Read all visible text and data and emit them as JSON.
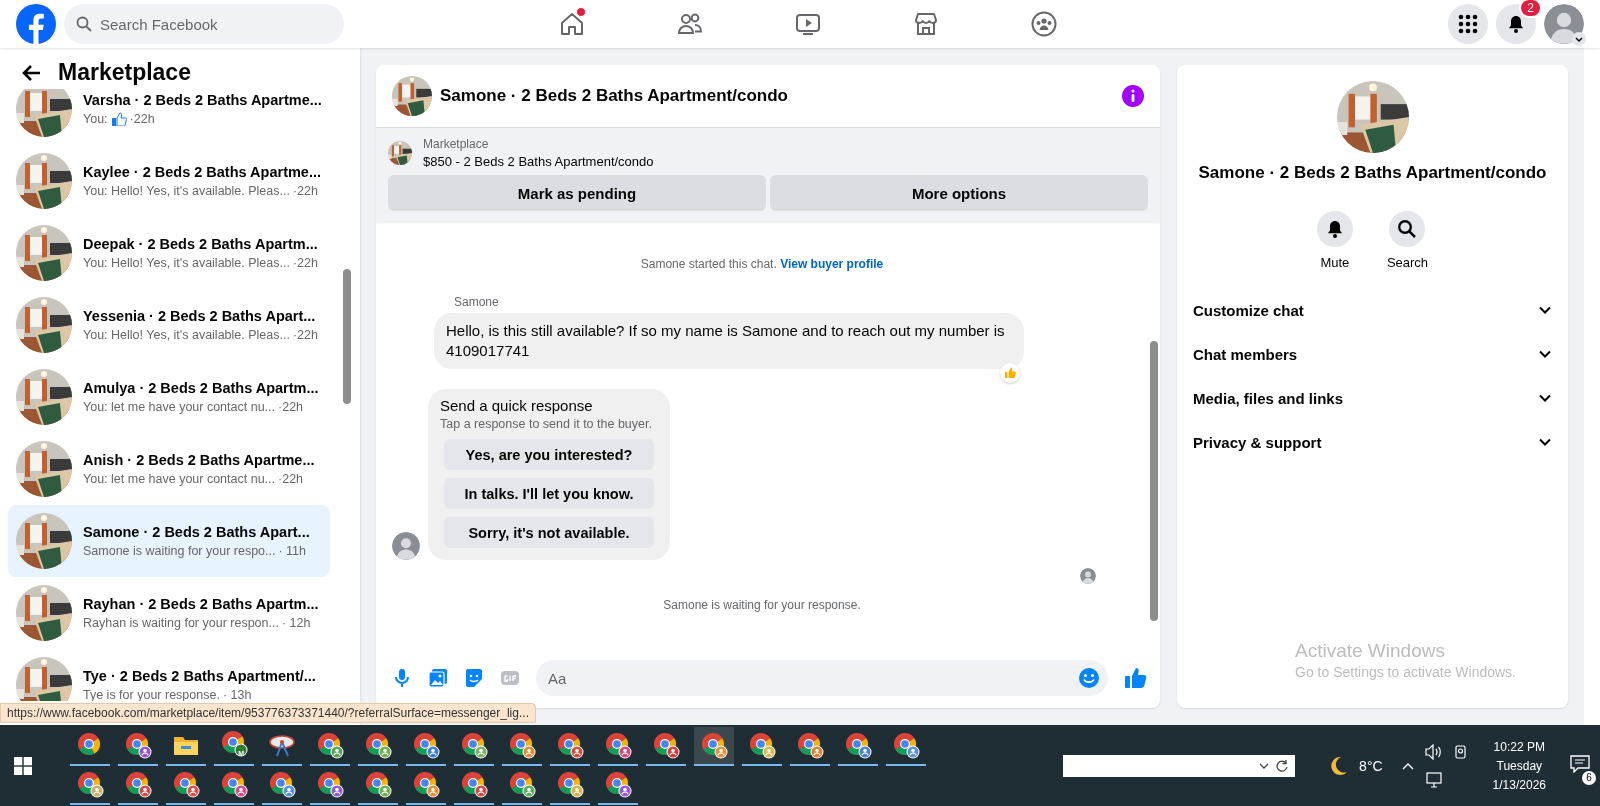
{
  "topbar": {
    "search": {
      "placeholder": "Search Facebook"
    },
    "nav": [
      {
        "kind": "home",
        "alert": true
      },
      {
        "kind": "friends",
        "alert": false
      },
      {
        "kind": "video",
        "alert": false
      },
      {
        "kind": "marketplace",
        "alert": false
      },
      {
        "kind": "groups",
        "alert": false
      }
    ],
    "notifications_badge": "2"
  },
  "sidebar": {
    "title": "Marketplace",
    "conversations": [
      {
        "name": "Varsha · 2 Beds 2 Baths Apartme...",
        "preview": "You:",
        "like_icon": true,
        "time": "·22h",
        "selected": false
      },
      {
        "name": "Kaylee · 2 Beds 2 Baths Apartme...",
        "preview": "You: Hello! Yes, it's available. Pleas...",
        "like_icon": false,
        "time": "·22h",
        "selected": false
      },
      {
        "name": "Deepak · 2 Beds 2 Baths Apartm...",
        "preview": "You: Hello! Yes, it's available. Pleas...",
        "like_icon": false,
        "time": "·22h",
        "selected": false
      },
      {
        "name": "Yessenia · 2 Beds 2 Baths Apart...",
        "preview": "You: Hello! Yes, it's available. Pleas...",
        "like_icon": false,
        "time": "·22h",
        "selected": false
      },
      {
        "name": "Amulya · 2 Beds 2 Baths Apartm...",
        "preview": "You: let me have your contact nu...",
        "like_icon": false,
        "time": "·22h",
        "selected": false
      },
      {
        "name": "Anish · 2 Beds 2 Baths Apartme...",
        "preview": "You: let me have your contact nu...",
        "like_icon": false,
        "time": "·22h",
        "selected": false
      },
      {
        "name": "Samone · 2 Beds 2 Baths Apart...",
        "preview": "Samone is waiting for your respo...",
        "like_icon": false,
        "time": "· 11h",
        "selected": true
      },
      {
        "name": "Rayhan · 2 Beds 2 Baths Apartm...",
        "preview": "Rayhan is waiting for your respon...",
        "like_icon": false,
        "time": "· 12h",
        "selected": false
      },
      {
        "name": "Tye · 2 Beds 2 Baths Apartment/...",
        "preview": "Tye is for your response.",
        "like_icon": false,
        "time": "· 13h",
        "selected": false
      }
    ]
  },
  "chat": {
    "title": "Samone · 2 Beds 2 Baths Apartment/condo",
    "listing": {
      "label": "Marketplace",
      "title": "$850 - 2 Beds 2 Baths Apartment/condo"
    },
    "actions": [
      "Mark as pending",
      "More options"
    ],
    "started": {
      "text": "Samone started this chat.",
      "link": "View buyer profile"
    },
    "messages": [
      {
        "sender": "Samone",
        "text": "Hello, is this still available? If so my name is Samone and to reach out my number is 4109017741",
        "reaction": true
      }
    ],
    "quick_response": {
      "title": "Send a quick response",
      "subtitle": "Tap a response to send it to the buyer.",
      "options": [
        "Yes, are you interested?",
        "In talks. I'll let you know.",
        "Sorry, it's not available."
      ]
    },
    "waiting": "Samone is waiting for your response.",
    "composer": {
      "placeholder": "Aa"
    }
  },
  "details": {
    "title": "Samone · 2 Beds 2 Baths Apartment/condo",
    "actions": [
      {
        "kind": "mute",
        "label": "Mute"
      },
      {
        "kind": "search",
        "label": "Search"
      }
    ],
    "sections": [
      {
        "label": "Customize chat",
        "expanded": false
      },
      {
        "label": "Chat members",
        "expanded": false
      },
      {
        "label": "Media, files and links",
        "expanded": false
      },
      {
        "label": "Privacy & support",
        "expanded": false
      }
    ],
    "watermark": {
      "title": "Activate Windows",
      "subtitle": "Go to Settings to activate Windows."
    }
  },
  "status_url": "https://www.facebook.com/marketplace/item/953776373371440/?referralSurface=messenger_lig...",
  "taskbar": {
    "apps": [
      {
        "kind": "chrome",
        "selected": false
      },
      {
        "kind": "chrome-profile",
        "color": "#9c4fd6",
        "selected": false
      },
      {
        "kind": "folder",
        "selected": false
      },
      {
        "kind": "chrome-letter",
        "letter": "M",
        "color": "#2e7d32",
        "selected": false
      },
      {
        "kind": "dish",
        "selected": false
      },
      {
        "kind": "chrome-profile",
        "color": "#5aa35a",
        "selected": false
      },
      {
        "kind": "chrome-profile",
        "color": "#6fae4f",
        "selected": false
      },
      {
        "kind": "chrome-profile",
        "color": "#3b7dd8",
        "selected": false
      },
      {
        "kind": "chrome-profile",
        "color": "#7fb069",
        "selected": false
      },
      {
        "kind": "chrome-profile",
        "color": "#e08a2c",
        "selected": false
      },
      {
        "kind": "chrome-profile",
        "color": "#e0483e",
        "selected": false
      },
      {
        "kind": "chrome-profile",
        "color": "#d6457a",
        "selected": false
      },
      {
        "kind": "chrome-profile",
        "color": "#d93a3a",
        "selected": false
      },
      {
        "kind": "chrome-profile",
        "color": "#e8913a",
        "selected": true
      },
      {
        "kind": "chrome-profile",
        "color": "#d9b84a",
        "selected": false
      },
      {
        "kind": "chrome-profile",
        "color": "#e57d2e",
        "selected": false
      },
      {
        "kind": "chrome-profile",
        "color": "#4a7fd0",
        "selected": false
      },
      {
        "kind": "chrome-profile",
        "color": "#5b8fd6",
        "selected": false
      },
      {
        "kind": "chrome-profile",
        "color": "#c9b06a",
        "selected": false
      },
      {
        "kind": "chrome-profile",
        "color": "#d94848",
        "selected": false
      },
      {
        "kind": "chrome-profile",
        "color": "#e04a4a",
        "selected": false
      },
      {
        "kind": "chrome-profile",
        "color": "#d64a8a",
        "selected": false
      },
      {
        "kind": "chrome-profile",
        "color": "#5a8fd8",
        "selected": false
      },
      {
        "kind": "chrome-profile",
        "color": "#8e5bd0",
        "selected": false
      },
      {
        "kind": "chrome-profile",
        "color": "#6fae4f",
        "selected": false
      },
      {
        "kind": "chrome-profile",
        "color": "#e88a36",
        "selected": false
      },
      {
        "kind": "chrome-profile",
        "color": "#d94545",
        "selected": false
      },
      {
        "kind": "chrome-profile",
        "color": "#5fa85f",
        "selected": false
      },
      {
        "kind": "chrome-profile",
        "color": "#d6b34a",
        "selected": false
      },
      {
        "kind": "chrome-profile",
        "color": "#9a55d4",
        "selected": false
      }
    ],
    "tray": {
      "temperature": "8°C",
      "time": "10:22 PM",
      "day": "Tuesday",
      "date": "1/13/2026",
      "notifications": "6"
    }
  }
}
